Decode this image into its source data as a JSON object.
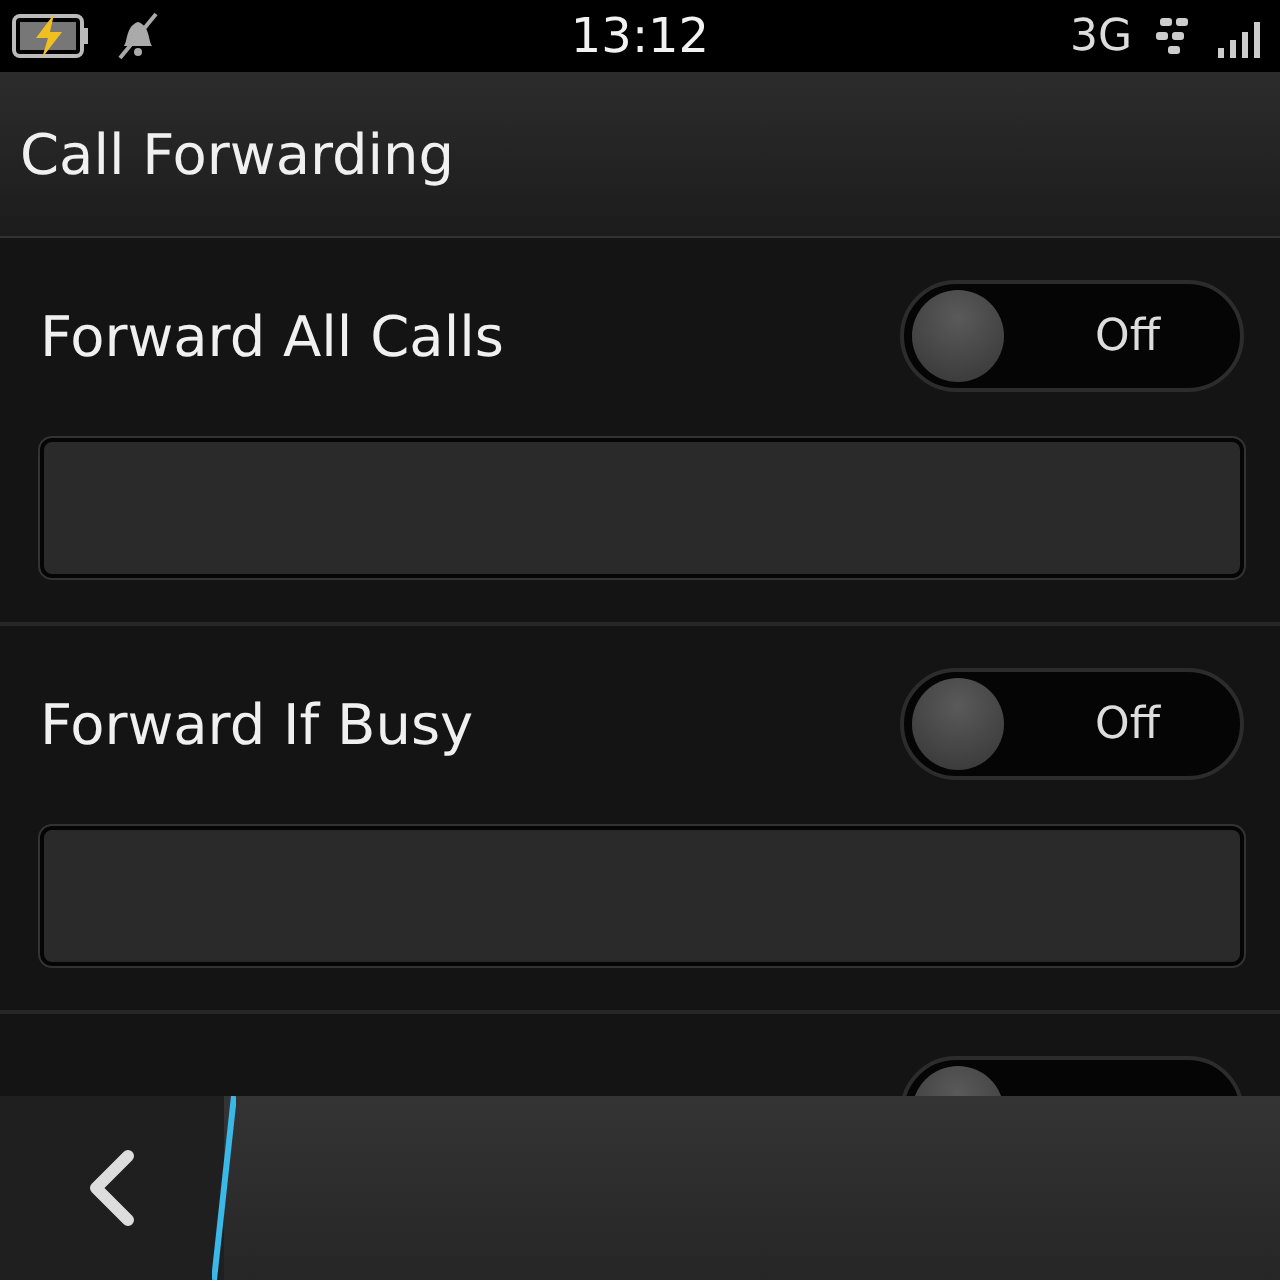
{
  "status_bar": {
    "time": "13:12",
    "network": "3G"
  },
  "title": "Call Forwarding",
  "settings": [
    {
      "kind": "toggle_field",
      "title": "Forward All Calls",
      "on": false,
      "toggle_label": "Off"
    },
    {
      "kind": "toggle_field",
      "title": "Forward If Busy",
      "on": false,
      "toggle_label": "Off"
    },
    {
      "kind": "cut_toggle",
      "on": false
    }
  ]
}
